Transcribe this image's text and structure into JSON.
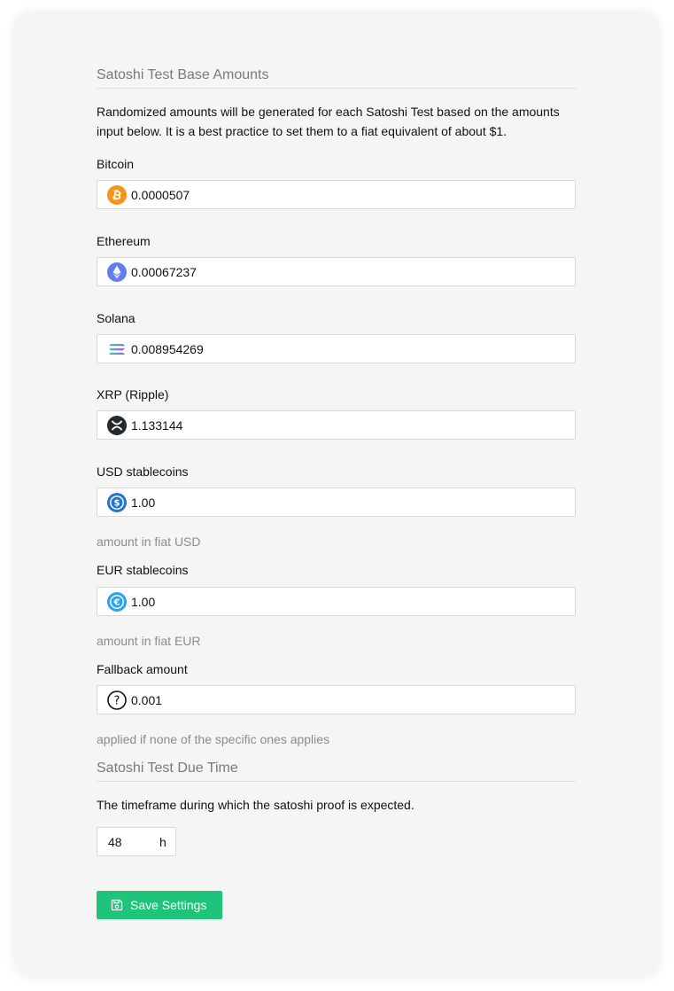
{
  "base_amounts": {
    "heading": "Satoshi Test Base Amounts",
    "description": "Randomized amounts will be generated for each Satoshi Test based on the amounts input below. It is a best practice to set them to a fiat equivalent of about $1.",
    "fields": [
      {
        "label": "Bitcoin",
        "value": "0.0000507",
        "icon": "bitcoin-icon"
      },
      {
        "label": "Ethereum",
        "value": "0.00067237",
        "icon": "ethereum-icon"
      },
      {
        "label": "Solana",
        "value": "0.008954269",
        "icon": "solana-icon"
      },
      {
        "label": "XRP (Ripple)",
        "value": "1.133144",
        "icon": "xrp-icon"
      },
      {
        "label": "USD stablecoins",
        "value": "1.00",
        "icon": "usd-coin-icon",
        "hint": "amount in fiat USD"
      },
      {
        "label": "EUR stablecoins",
        "value": "1.00",
        "icon": "eur-coin-icon",
        "hint": "amount in fiat EUR"
      },
      {
        "label": "Fallback amount",
        "value": "0.001",
        "icon": "question-circle-icon",
        "hint": "applied if none of the specific ones applies"
      }
    ]
  },
  "due_time": {
    "heading": "Satoshi Test Due Time",
    "description": "The timeframe during which the satoshi proof is expected.",
    "value": "48",
    "unit": "h"
  },
  "save_button": {
    "label": "Save Settings",
    "icon": "save-icon"
  },
  "colors": {
    "bitcoin": "#f7931a",
    "ethereum": "#627eea",
    "xrp": "#23292f",
    "usd_coin": "#2775ca",
    "eur_coin": "#2aa3ef",
    "save_button": "#1ec47a",
    "card_background": "#f5f5f5"
  }
}
